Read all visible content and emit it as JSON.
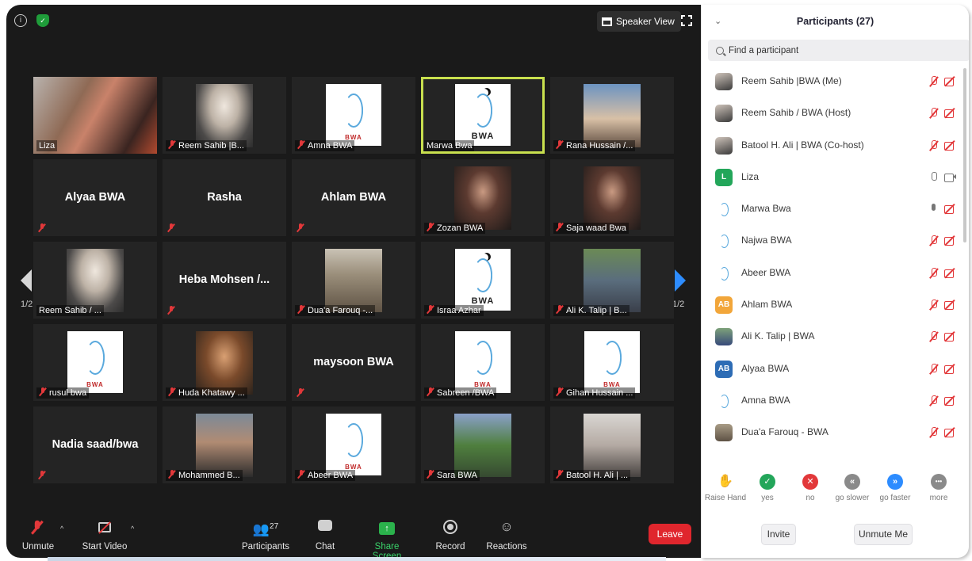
{
  "meeting": {
    "speaker_view_label": "Speaker View",
    "page_indicator": "1/2",
    "tiles": [
      {
        "label": "Liza",
        "kind": "photo",
        "style": "liza"
      },
      {
        "label": "Reem Sahib |B...",
        "kind": "photo",
        "style": "hijab",
        "muted": true
      },
      {
        "label": "Amna BWA",
        "kind": "logo",
        "muted": true
      },
      {
        "label": "Marwa Bwa",
        "kind": "logo",
        "active": true
      },
      {
        "label": "Rana Hussain /...",
        "kind": "photo",
        "style": "laptop",
        "muted": true
      },
      {
        "name": "Alyaa BWA",
        "kind": "name",
        "muted": true
      },
      {
        "name": "Rasha",
        "kind": "name",
        "muted": true
      },
      {
        "name": "Ahlam BWA",
        "kind": "name",
        "muted": true
      },
      {
        "label": "Zozan BWA",
        "kind": "photo",
        "style": "dark",
        "muted": true
      },
      {
        "label": "Saja waad Bwa",
        "kind": "photo",
        "style": "dark",
        "muted": true
      },
      {
        "label": "Reem Sahib / ...",
        "kind": "photo",
        "style": "hijab"
      },
      {
        "name": "Heba Mohsen /...",
        "kind": "name",
        "muted": true
      },
      {
        "label": "Dua'a Farouq -...",
        "kind": "photo",
        "style": "stairs",
        "muted": true
      },
      {
        "label": "Israa Azhar",
        "kind": "logo",
        "muted": true
      },
      {
        "label": "Ali K. Talip | B...",
        "kind": "photo",
        "style": "street",
        "muted": true
      },
      {
        "label": "rusul bwa",
        "kind": "logo",
        "muted": true
      },
      {
        "label": "Huda Khatawy ...",
        "kind": "photo",
        "style": "huda",
        "muted": true
      },
      {
        "name": "maysoon BWA",
        "kind": "name",
        "muted": true
      },
      {
        "label": "Sabreen /BWA",
        "kind": "logo",
        "muted": true
      },
      {
        "label": "Gihan Hussain ...",
        "kind": "logo",
        "muted": true
      },
      {
        "name": "Nadia saad/bwa",
        "kind": "name",
        "muted": true
      },
      {
        "label": "Mohammed B...",
        "kind": "photo",
        "style": "car",
        "muted": true
      },
      {
        "label": "Abeer BWA",
        "kind": "logo",
        "muted": true
      },
      {
        "label": "Sara BWA",
        "kind": "photo",
        "style": "green",
        "muted": true
      },
      {
        "label": "Batool H. Ali | ...",
        "kind": "photo",
        "style": "room",
        "muted": true
      }
    ],
    "logo_text": "BWA"
  },
  "toolbar": {
    "unmute": "Unmute",
    "start_video": "Start Video",
    "participants": "Participants",
    "participants_count": "27",
    "chat": "Chat",
    "share_screen": "Share Screen",
    "record": "Record",
    "reactions": "Reactions",
    "leave": "Leave"
  },
  "panel": {
    "title": "Participants (27)",
    "search_placeholder": "Find a participant",
    "participants": [
      {
        "name": "Reem Sahib |BWA (Me)",
        "avatar": "photo",
        "mic": "off",
        "cam": "off"
      },
      {
        "name": "Reem Sahib / BWA (Host)",
        "avatar": "photo",
        "mic": "off",
        "cam": "off"
      },
      {
        "name": "Batool H. Ali | BWA (Co-host)",
        "avatar": "photo",
        "mic": "off",
        "cam": "off"
      },
      {
        "name": "Liza",
        "avatar": "letter",
        "letter": "L",
        "color": "#23a65a",
        "mic": "on",
        "cam": "on"
      },
      {
        "name": "Marwa Bwa",
        "avatar": "logo",
        "mic": "live",
        "cam": "off"
      },
      {
        "name": "Najwa BWA",
        "avatar": "logo",
        "mic": "off",
        "cam": "off"
      },
      {
        "name": "Abeer BWA",
        "avatar": "logo",
        "mic": "off",
        "cam": "off"
      },
      {
        "name": "Ahlam BWA",
        "avatar": "letter",
        "letter": "AB",
        "color": "#f2a63a",
        "mic": "off",
        "cam": "off"
      },
      {
        "name": "Ali K. Talip | BWA",
        "avatar": "street",
        "mic": "off",
        "cam": "off"
      },
      {
        "name": "Alyaa BWA",
        "avatar": "letter",
        "letter": "AB",
        "color": "#2d6cb5",
        "mic": "off",
        "cam": "off"
      },
      {
        "name": "Amna BWA",
        "avatar": "logo",
        "mic": "off",
        "cam": "off"
      },
      {
        "name": "Dua'a Farouq - BWA",
        "avatar": "stairs",
        "mic": "off",
        "cam": "off"
      }
    ],
    "feedback": [
      {
        "label": "Raise Hand",
        "type": "hand"
      },
      {
        "label": "yes",
        "type": "circle",
        "glyph": "✓",
        "color": "#23a65a"
      },
      {
        "label": "no",
        "type": "circle",
        "glyph": "✕",
        "color": "#e2383a"
      },
      {
        "label": "go slower",
        "type": "circle",
        "glyph": "«",
        "color": "#8a8a8a"
      },
      {
        "label": "go faster",
        "type": "circle",
        "glyph": "»",
        "color": "#2d8cff"
      },
      {
        "label": "more",
        "type": "circle",
        "glyph": "•••",
        "color": "#8a8a8a"
      }
    ],
    "invite": "Invite",
    "unmute_me": "Unmute Me"
  }
}
